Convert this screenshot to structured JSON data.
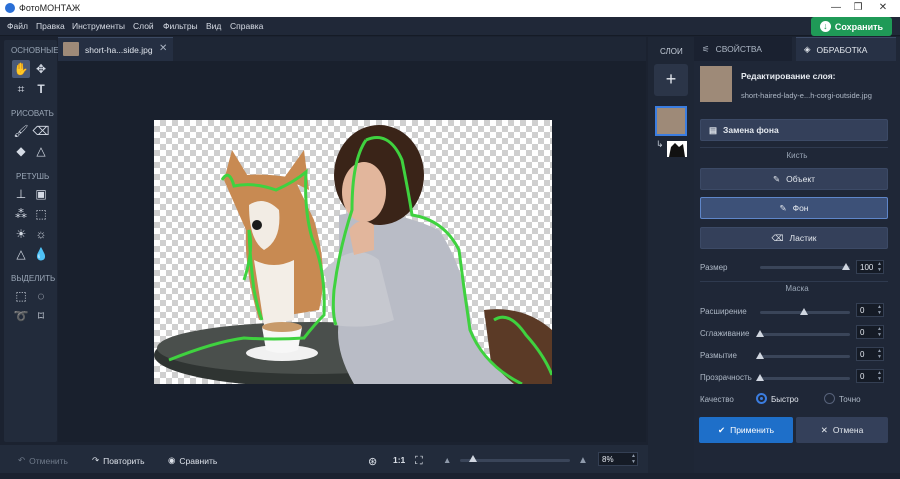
{
  "app": {
    "title": "ФотоМОНТАЖ",
    "save_label": "Сохранить"
  },
  "menu": [
    "Файл",
    "Правка",
    "Инструменты",
    "Слой",
    "Фильтры",
    "Вид",
    "Справка"
  ],
  "toolbar": {
    "sections": {
      "basic": "ОСНОВНЫЕ",
      "draw": "РИСОВАТЬ",
      "retouch": "РЕТУШЬ",
      "select": "ВЫДЕЛИТЬ"
    },
    "icons": [
      "hand-icon",
      "move-icon",
      "crop-icon",
      "text-icon",
      "brush-icon",
      "eraser-icon",
      "fill-icon",
      "shapes-icon",
      "stamp-icon",
      "heal-icon",
      "pattern-icon",
      "patch-icon",
      "dodge-icon",
      "burn-icon",
      "sharpen-icon",
      "blur-drop-icon",
      "rect-select-icon",
      "ellipse-select-icon",
      "lasso-icon",
      "poly-lasso-icon"
    ]
  },
  "document": {
    "tab_name": "short-ha...side.jpg"
  },
  "bottom": {
    "undo": "Отменить",
    "redo": "Повторить",
    "compare": "Сравнить",
    "ratio": "1:1",
    "zoom": "8%",
    "zoom_level": 0.08
  },
  "layers": {
    "title": "СЛОИ"
  },
  "panel": {
    "tab_props": "СВОЙСТВА",
    "tab_processing": "ОБРАБОТКА",
    "edit_title": "Редактирование слоя:",
    "edit_file": "short-haired-lady-e...h-corgi-outside.jpg",
    "replace_bg": "Замена фона",
    "brush_header": "Кисть",
    "object_btn": "Объект",
    "bg_btn": "Фон",
    "eraser_btn": "Ластик",
    "size_label": "Размер",
    "size_value": "100",
    "mask_header": "Маска",
    "expand_label": "Расширение",
    "expand_value": "0",
    "smooth_label": "Сглаживание",
    "smooth_value": "0",
    "blur_label": "Размытие",
    "blur_value": "0",
    "opacity_label": "Прозрачность",
    "opacity_value": "0",
    "quality_label": "Качество",
    "fast_label": "Быстро",
    "precise_label": "Точно",
    "apply": "Применить",
    "cancel": "Отмена"
  },
  "colors": {
    "accent": "#3b7de0",
    "save": "#1f9a57",
    "apply": "#1e6fc9",
    "outline": "#3fd23f"
  }
}
